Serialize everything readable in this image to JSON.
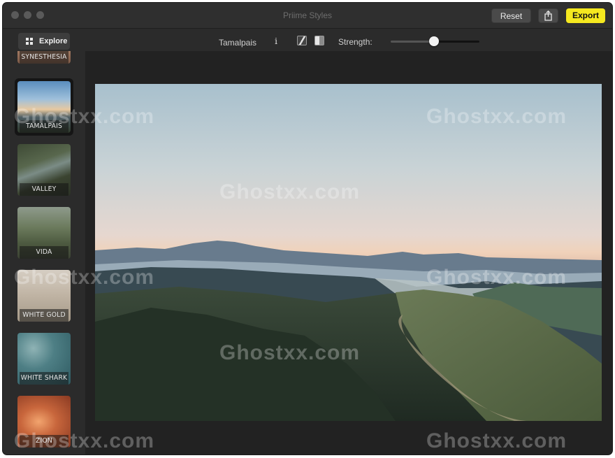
{
  "window": {
    "title": "Priime Styles"
  },
  "buttons": {
    "reset": "Reset",
    "export": "Export",
    "share_icon": "share-icon"
  },
  "toolbar": {
    "explore_label": "Explore",
    "style_name": "Tamalpais",
    "info_icon": "i",
    "strength_label": "Strength:",
    "strength_value": 0.49
  },
  "sidebar": {
    "items": [
      {
        "label": "SYNESTHESIA"
      },
      {
        "label": "TAMALPAIS",
        "selected": true
      },
      {
        "label": "VALLEY"
      },
      {
        "label": "VIDA"
      },
      {
        "label": "WHITE GOLD"
      },
      {
        "label": "WHITE SHARK"
      },
      {
        "label": "ZION"
      }
    ]
  },
  "watermark": "Ghostxx.com",
  "colors": {
    "export_accent": "#f5e81f",
    "window_bg": "#2b2b2b",
    "canvas_bg": "#222222"
  }
}
